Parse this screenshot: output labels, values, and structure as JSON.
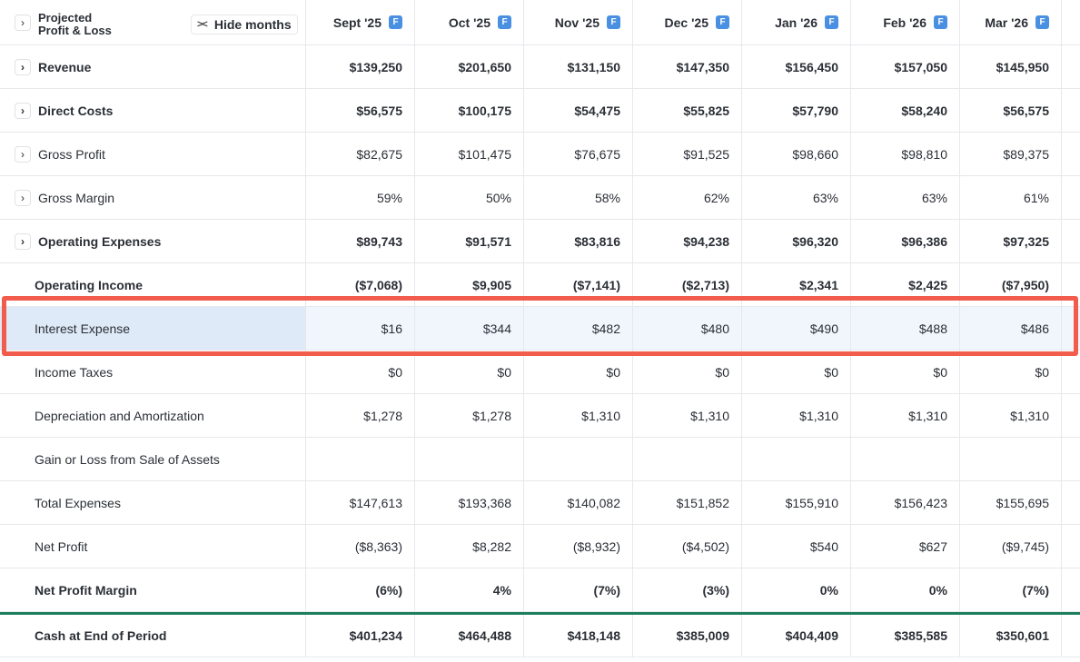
{
  "header": {
    "title_line1": "Projected",
    "title_line2": "Profit & Loss",
    "hide_months_label": "Hide months",
    "months": [
      "Sept '25",
      "Oct '25",
      "Nov '25",
      "Dec '25",
      "Jan '26",
      "Feb '26",
      "Mar '26"
    ],
    "forecast_badge": "F"
  },
  "rows": [
    {
      "label": "Revenue",
      "values": [
        "$139,250",
        "$201,650",
        "$131,150",
        "$147,350",
        "$156,450",
        "$157,050",
        "$145,950"
      ]
    },
    {
      "label": "Direct Costs",
      "values": [
        "$56,575",
        "$100,175",
        "$54,475",
        "$55,825",
        "$57,790",
        "$58,240",
        "$56,575"
      ]
    },
    {
      "label": "Gross Profit",
      "values": [
        "$82,675",
        "$101,475",
        "$76,675",
        "$91,525",
        "$98,660",
        "$98,810",
        "$89,375"
      ]
    },
    {
      "label": "Gross Margin",
      "values": [
        "59%",
        "50%",
        "58%",
        "62%",
        "63%",
        "63%",
        "61%"
      ]
    },
    {
      "label": "Operating Expenses",
      "values": [
        "$89,743",
        "$91,571",
        "$83,816",
        "$94,238",
        "$96,320",
        "$96,386",
        "$97,325"
      ]
    },
    {
      "label": "Operating Income",
      "values": [
        "($7,068)",
        "$9,905",
        "($7,141)",
        "($2,713)",
        "$2,341",
        "$2,425",
        "($7,950)"
      ]
    },
    {
      "label": "Interest Expense",
      "values": [
        "$16",
        "$344",
        "$482",
        "$480",
        "$490",
        "$488",
        "$486"
      ]
    },
    {
      "label": "Income Taxes",
      "values": [
        "$0",
        "$0",
        "$0",
        "$0",
        "$0",
        "$0",
        "$0"
      ]
    },
    {
      "label": "Depreciation and Amortization",
      "values": [
        "$1,278",
        "$1,278",
        "$1,310",
        "$1,310",
        "$1,310",
        "$1,310",
        "$1,310"
      ]
    },
    {
      "label": "Gain or Loss from Sale of Assets",
      "values": [
        "",
        "",
        "",
        "",
        "",
        "",
        ""
      ]
    },
    {
      "label": "Total Expenses",
      "values": [
        "$147,613",
        "$193,368",
        "$140,082",
        "$151,852",
        "$155,910",
        "$156,423",
        "$155,695"
      ]
    },
    {
      "label": "Net Profit",
      "values": [
        "($8,363)",
        "$8,282",
        "($8,932)",
        "($4,502)",
        "$540",
        "$627",
        "($9,745)"
      ]
    },
    {
      "label": "Net Profit Margin",
      "values": [
        "(6%)",
        "4%",
        "(7%)",
        "(3%)",
        "0%",
        "0%",
        "(7%)"
      ]
    }
  ],
  "total_row": {
    "label": "Cash at End of Period",
    "values": [
      "$401,234",
      "$464,488",
      "$418,148",
      "$385,009",
      "$404,409",
      "$385,585",
      "$350,601"
    ]
  },
  "colors": {
    "highlight_border": "#f25c4c",
    "highlight_fill": "#f1f6fd",
    "badge": "#4a90e2",
    "total_rule": "#1d7f5f"
  }
}
